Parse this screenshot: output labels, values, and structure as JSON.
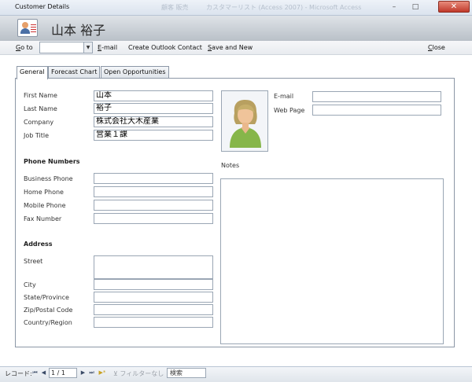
{
  "window": {
    "title": "Customer Details",
    "background_ghosts": [
      "顧客 販売 ",
      "カスタマーリスト (Access 2007) - Microsoft Access"
    ],
    "minimize": "–",
    "maximize": "□",
    "close": "✕"
  },
  "header": {
    "icon": "customer-card-icon",
    "name": "山本 裕子"
  },
  "toolbar": {
    "goto_label": "Go to",
    "goto_value": "",
    "email_label": "E-mail",
    "outlook_label": "Create Outlook Contact",
    "save_new_label": "Save and New",
    "close_label": "Close"
  },
  "tabs": [
    {
      "label": "General",
      "active": true
    },
    {
      "label": "Forecast Chart",
      "active": false
    },
    {
      "label": "Open Opportunities",
      "active": false
    }
  ],
  "general": {
    "first_name_label": "First Name",
    "first_name": "山本",
    "last_name_label": "Last Name",
    "last_name": "裕子",
    "company_label": "Company",
    "company": "株式会社大木産業",
    "job_title_label": "Job Title",
    "job_title": "営業１課",
    "phone_section": "Phone Numbers",
    "business_phone_label": "Business Phone",
    "business_phone": "",
    "home_phone_label": "Home Phone",
    "home_phone": "",
    "mobile_phone_label": "Mobile Phone",
    "mobile_phone": "",
    "fax_label": "Fax Number",
    "fax": "",
    "address_section": "Address",
    "street_label": "Street",
    "street": "",
    "city_label": "City",
    "city": "",
    "state_label": "State/Province",
    "state": "",
    "zip_label": "Zip/Postal Code",
    "zip": "",
    "country_label": "Country/Region",
    "country": "",
    "email_label": "E-mail",
    "email": "",
    "web_label": "Web Page",
    "web": "",
    "notes_label": "Notes",
    "notes": ""
  },
  "statusbar": {
    "record_label": "レコード:",
    "first": "⏮",
    "prev": "◀",
    "record_value": "1 / 1",
    "next": "▶",
    "last": "⏭",
    "new": "▶*",
    "filter_label": "フィルターなし",
    "search_label": "検索"
  },
  "colors": {
    "header_gradient_top": "#dfe3e8",
    "header_gradient_bottom": "#b9c0c8",
    "border": "#9aa6b4",
    "close_button": "#c0392b"
  }
}
